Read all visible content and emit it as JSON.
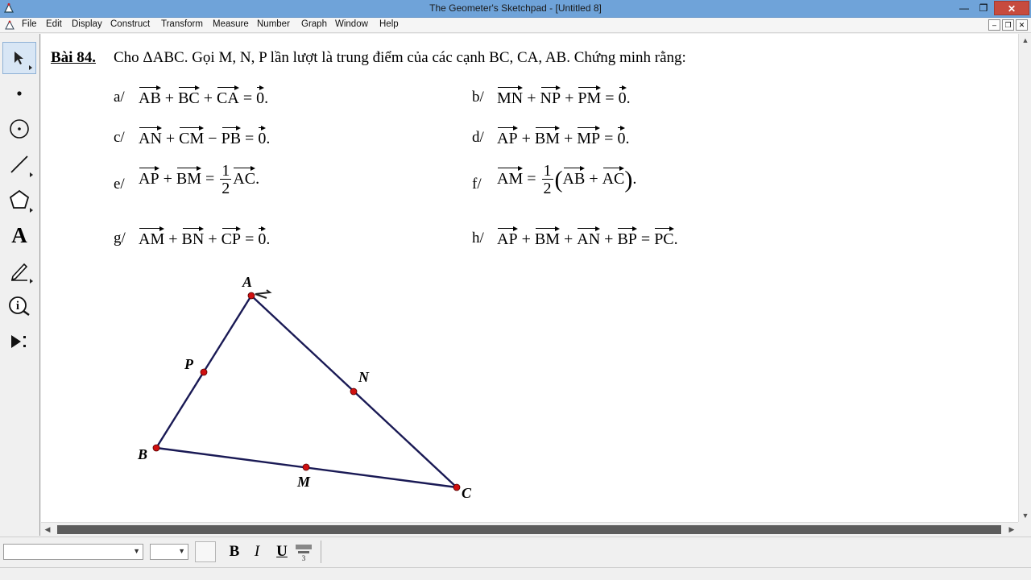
{
  "window": {
    "title": "The Geometer's Sketchpad - [Untitled 8]",
    "min_glyph": "—",
    "restore_glyph": "❐",
    "close_glyph": "✕"
  },
  "menu": [
    {
      "label": "File"
    },
    {
      "label": "Edit"
    },
    {
      "label": "Display"
    },
    {
      "label": "Construct"
    },
    {
      "label": "Transform"
    },
    {
      "label": "Measure"
    },
    {
      "label": "Number"
    },
    {
      "label": "Graph"
    },
    {
      "label": "Window"
    },
    {
      "label": "Help"
    }
  ],
  "mdi": {
    "min": "–",
    "restore": "❐",
    "close": "✕"
  },
  "tools": [
    {
      "name": "arrow-tool-icon",
      "selected": true
    },
    {
      "name": "point-tool-icon"
    },
    {
      "name": "compass-tool-icon"
    },
    {
      "name": "straightedge-tool-icon"
    },
    {
      "name": "polygon-tool-icon"
    },
    {
      "name": "text-tool-icon",
      "glyph": "A"
    },
    {
      "name": "marker-tool-icon"
    },
    {
      "name": "information-tool-icon",
      "glyph": "i"
    },
    {
      "name": "custom-tool-icon",
      "glyph": "▶⁝"
    }
  ],
  "problem": {
    "title": "Bài 84.",
    "statement": "Cho ΔABC. Gọi M, N, P lần lượt là trung điểm của các cạnh BC, CA, AB. Chứng minh rằng:",
    "items": [
      {
        "label": "a/",
        "t": [
          "AB",
          "+",
          "BC",
          "+",
          "CA",
          "=",
          "0",
          "."
        ]
      },
      {
        "label": "b/",
        "t": [
          "MN",
          "+",
          "NP",
          "+",
          "PM",
          "=",
          "0",
          "."
        ]
      },
      {
        "label": "c/",
        "t": [
          "AN",
          "+",
          "CM",
          "−",
          "PB",
          "=",
          "0",
          "."
        ]
      },
      {
        "label": "d/",
        "t": [
          "AP",
          "+",
          "BM",
          "+",
          "MP",
          "=",
          "0",
          "."
        ]
      },
      {
        "label": "e/",
        "t": [
          "AP",
          "+",
          "BM",
          "=",
          "1",
          "2",
          "AC",
          "."
        ]
      },
      {
        "label": "f/",
        "t": [
          "AM",
          "=",
          "1",
          "2",
          "(",
          "AB",
          "+",
          "AC",
          ")",
          "."
        ]
      },
      {
        "label": "g/",
        "t": [
          "AM",
          "+",
          "BN",
          "+",
          "CP",
          "=",
          "0",
          "."
        ]
      },
      {
        "label": "h/",
        "t": [
          "AP",
          "+",
          "BM",
          "+",
          "AN",
          "+",
          "BP",
          "=",
          "PC",
          "."
        ]
      }
    ]
  },
  "figure": {
    "points": [
      {
        "name": "A"
      },
      {
        "name": "B"
      },
      {
        "name": "C"
      },
      {
        "name": "M"
      },
      {
        "name": "N"
      },
      {
        "name": "P"
      }
    ],
    "segment_color": "#1a1a55",
    "point_color": "#d01010"
  },
  "scrollbar": {
    "up": "▲",
    "down": "▼",
    "left": "◀",
    "right": "▶"
  },
  "text_toolbar": {
    "font_select": "",
    "size_select": "",
    "drop_glyph": "▼",
    "bold": "B",
    "italic": "I",
    "underline": "U"
  }
}
